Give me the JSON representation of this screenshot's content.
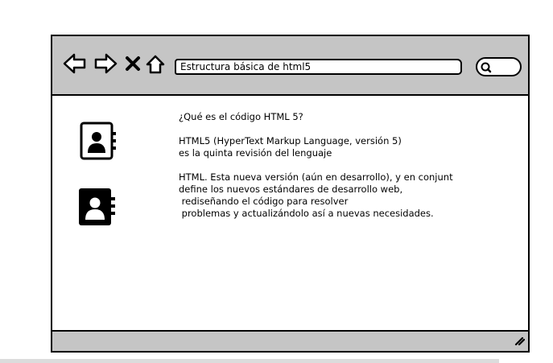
{
  "toolbar": {
    "address_value": "Estructura básica de html5",
    "icons": [
      "back-arrow-icon",
      "forward-arrow-icon",
      "close-x-icon",
      "home-icon",
      "search-icon"
    ]
  },
  "content": {
    "question": "¿Qué es el código HTML 5?",
    "def_line1": "HTML5 (HyperText Markup Language, versión 5)",
    "def_line2": "es la quinta revisión del lenguaje",
    "desc_line1": "HTML. Esta nueva versión (aún en desarrollo), y en conjunt",
    "desc_line2": "define los nuevos estándares de desarrollo web,",
    "desc_line3": " rediseñando el código para resolver",
    "desc_line4": " problemas y actualizándolo así a nuevas necesidades."
  },
  "sidebar": {
    "icons": [
      "contact-book-icon",
      "contact-book-filled-icon"
    ]
  },
  "colors": {
    "chrome_gray": "#c5c5c5",
    "border": "#000000",
    "background": "#ffffff"
  }
}
